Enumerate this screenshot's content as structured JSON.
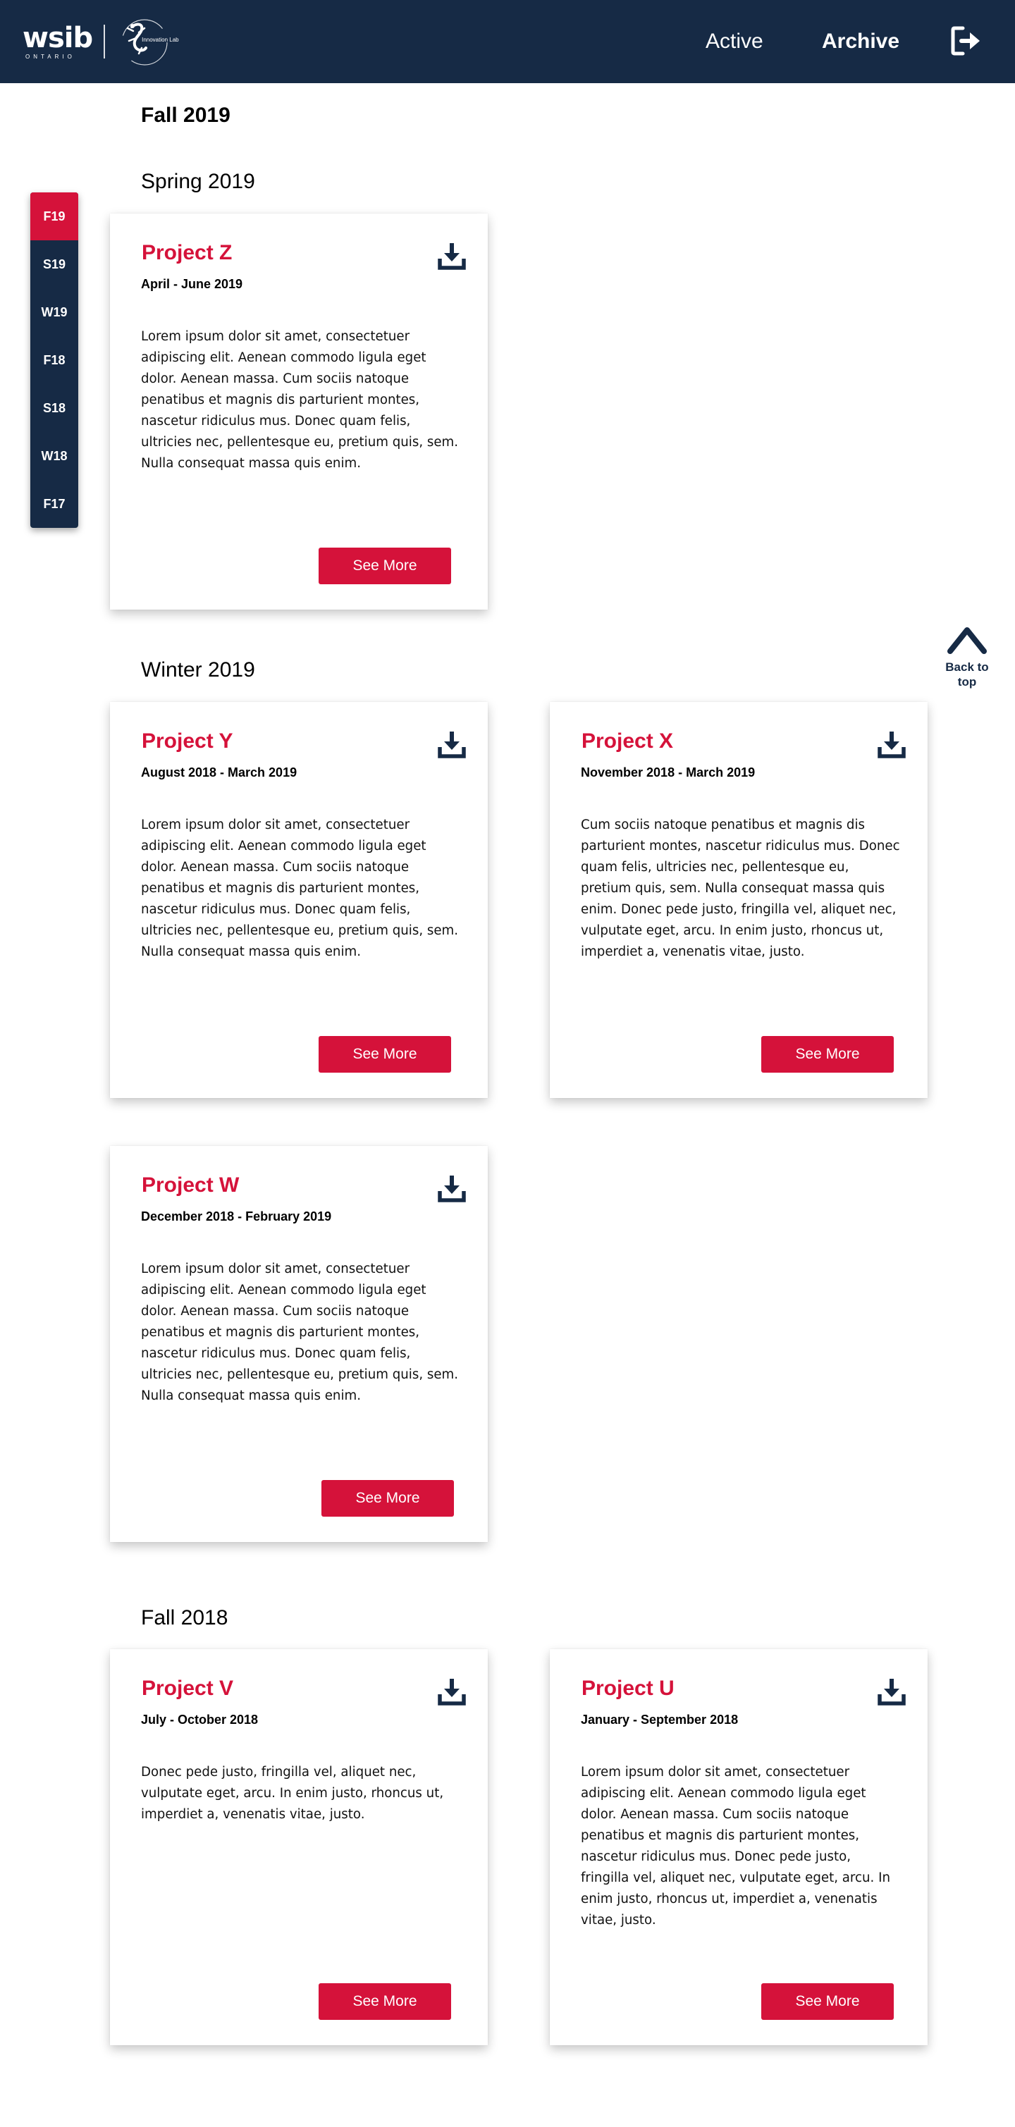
{
  "header": {
    "logo_text": "wsib",
    "logo_sub": "ONTARIO",
    "lab_text": "Innovation Lab",
    "nav": {
      "active": "Active",
      "archive": "Archive"
    }
  },
  "sidenav": {
    "items": [
      {
        "label": "F19",
        "active": true
      },
      {
        "label": "S19",
        "active": false
      },
      {
        "label": "W19",
        "active": false
      },
      {
        "label": "F18",
        "active": false
      },
      {
        "label": "S18",
        "active": false
      },
      {
        "label": "W18",
        "active": false
      },
      {
        "label": "F17",
        "active": false
      }
    ]
  },
  "back_to_top": {
    "line1": "Back to",
    "line2": "top"
  },
  "terms": {
    "fall2019": "Fall 2019",
    "spring2019": "Spring 2019",
    "winter2019": "Winter 2019",
    "fall2018": "Fall 2018"
  },
  "projects": {
    "z": {
      "title": "Project Z",
      "dates": "April - June 2019",
      "description": "Lorem ipsum dolor sit amet, consectetuer adipiscing elit. Aenean commodo ligula eget dolor. Aenean massa. Cum sociis natoque penatibus et magnis dis parturient montes, nascetur ridiculus mus. Donec quam felis, ultricies nec, pellentesque eu, pretium quis, sem. Nulla consequat massa quis enim.",
      "button": "See More"
    },
    "y": {
      "title": "Project Y",
      "dates": "August 2018 - March 2019",
      "description": "Lorem ipsum dolor sit amet, consectetuer adipiscing elit. Aenean commodo ligula eget dolor. Aenean massa. Cum sociis natoque penatibus et magnis dis parturient montes, nascetur ridiculus mus. Donec quam felis, ultricies nec, pellentesque eu, pretium quis, sem. Nulla consequat massa quis enim.",
      "button": "See More"
    },
    "x": {
      "title": "Project X",
      "dates": "November 2018 - March 2019",
      "description": "Cum sociis natoque penatibus et magnis dis parturient montes, nascetur ridiculus mus. Donec quam felis, ultricies nec, pellentesque eu, pretium quis, sem. Nulla consequat massa quis enim. Donec pede justo, fringilla vel, aliquet nec, vulputate eget, arcu. In enim justo, rhoncus ut, imperdiet a, venenatis vitae, justo.",
      "button": "See More"
    },
    "w": {
      "title": "Project W",
      "dates": "December 2018 - February 2019",
      "description": "Lorem ipsum dolor sit amet, consectetuer adipiscing elit. Aenean commodo ligula eget dolor. Aenean massa. Cum sociis natoque penatibus et magnis dis parturient montes, nascetur ridiculus mus. Donec quam felis, ultricies nec, pellentesque eu, pretium quis, sem. Nulla consequat massa quis enim.",
      "button": "See More"
    },
    "v": {
      "title": "Project V",
      "dates": "July - October 2018",
      "description": "Donec pede justo, fringilla vel, aliquet nec, vulputate eget, arcu. In enim justo, rhoncus ut, imperdiet a, venenatis vitae, justo.",
      "button": "See More"
    },
    "u": {
      "title": "Project U",
      "dates": "January - September 2018",
      "description": "Lorem ipsum dolor sit amet, consectetuer adipiscing elit. Aenean commodo ligula eget dolor. Aenean massa. Cum sociis natoque penatibus et magnis dis parturient montes, nascetur ridiculus mus. Donec pede justo, fringilla vel, aliquet nec, vulputate eget, arcu. In enim justo, rhoncus ut, imperdiet a, venenatis vitae, justo.",
      "button": "See More"
    }
  },
  "colors": {
    "navy": "#162a45",
    "accent_red": "#d5123a"
  }
}
